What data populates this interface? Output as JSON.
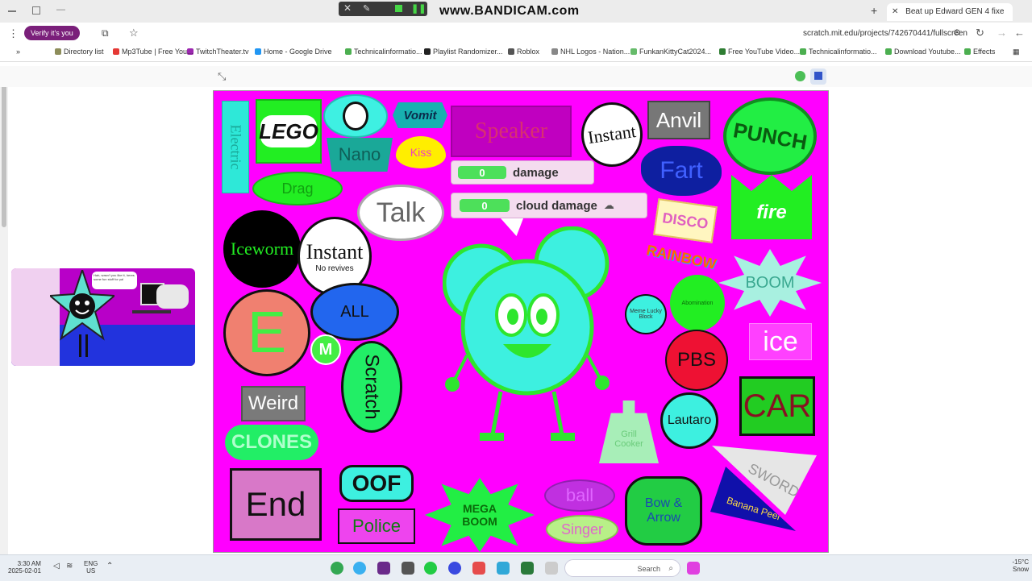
{
  "browser": {
    "tab_title": "Beat up Edward GEN 4 fixe",
    "watermark": "www.BANDICAM.com",
    "url": "scratch.mit.edu/projects/742670441/fullscreen",
    "profile_label": "Verify it's you",
    "bookmarks": [
      "Effects",
      "Download Youtube...",
      "Technicalinformatio...",
      "Free YouTube Video...",
      "FunkanKittyCat2024...",
      "NHL Logos - Nation...",
      "Roblox",
      "Playlist Randomizer...",
      "Technicalinformatio...",
      "Home - Google Drive",
      "TwitchTheater.tv",
      "Mp3Tube | Free You...",
      "Directory list"
    ]
  },
  "stage": {
    "monitors": [
      {
        "label": "damage",
        "value": "0"
      },
      {
        "label": "cloud damage",
        "value": "0"
      }
    ],
    "items": {
      "electric": "Electric",
      "lego": "LEGO",
      "vomit": "Vomit",
      "speaker": "Speaker",
      "instant1": "Instant",
      "anvil": "Anvil",
      "punch": "PUNCH",
      "kiss": "Kiss",
      "nano": "Nano",
      "drag": "Drag",
      "talk": "Talk",
      "fart": "Fart",
      "disco": "DISCO",
      "fire": "fire",
      "iceworm": "Iceworm",
      "instant2": "Instant",
      "no_revives": "No revives",
      "rainbow": "RAINBOW",
      "boom": "BOOM",
      "all": "ALL",
      "e": "E",
      "scratch": "Scratch",
      "meme": "Meme Lucky Block",
      "abomination": "Abomination",
      "ice": "ice",
      "pbs": "PBS",
      "weird": "Weird",
      "clones": "CLONES",
      "lautaro": "Lautaro",
      "car": "CAR",
      "grill": "Grill Cooker",
      "sword": "SWORD",
      "end": "End",
      "oof": "OOF",
      "police": "Police",
      "megaboom": "MEGA BOOM",
      "ball": "ball",
      "singer": "Singer",
      "bow": "Bow & Arrow",
      "banana": "Banana Peel"
    }
  },
  "thumbnail": {
    "bubble_text": "Hah, wasn't you like it, heres some fun stuff for ya!"
  },
  "taskbar": {
    "weather_temp": "-15°C",
    "weather_desc": "Snow",
    "search": "Search",
    "lang": "ENG",
    "region": "US",
    "time": "3:30 AM",
    "date": "2025-02-01"
  },
  "colors": {
    "stage_bg": "#ff00ff",
    "character_body": "#3df0e0",
    "character_outline": "#2ee62e"
  }
}
